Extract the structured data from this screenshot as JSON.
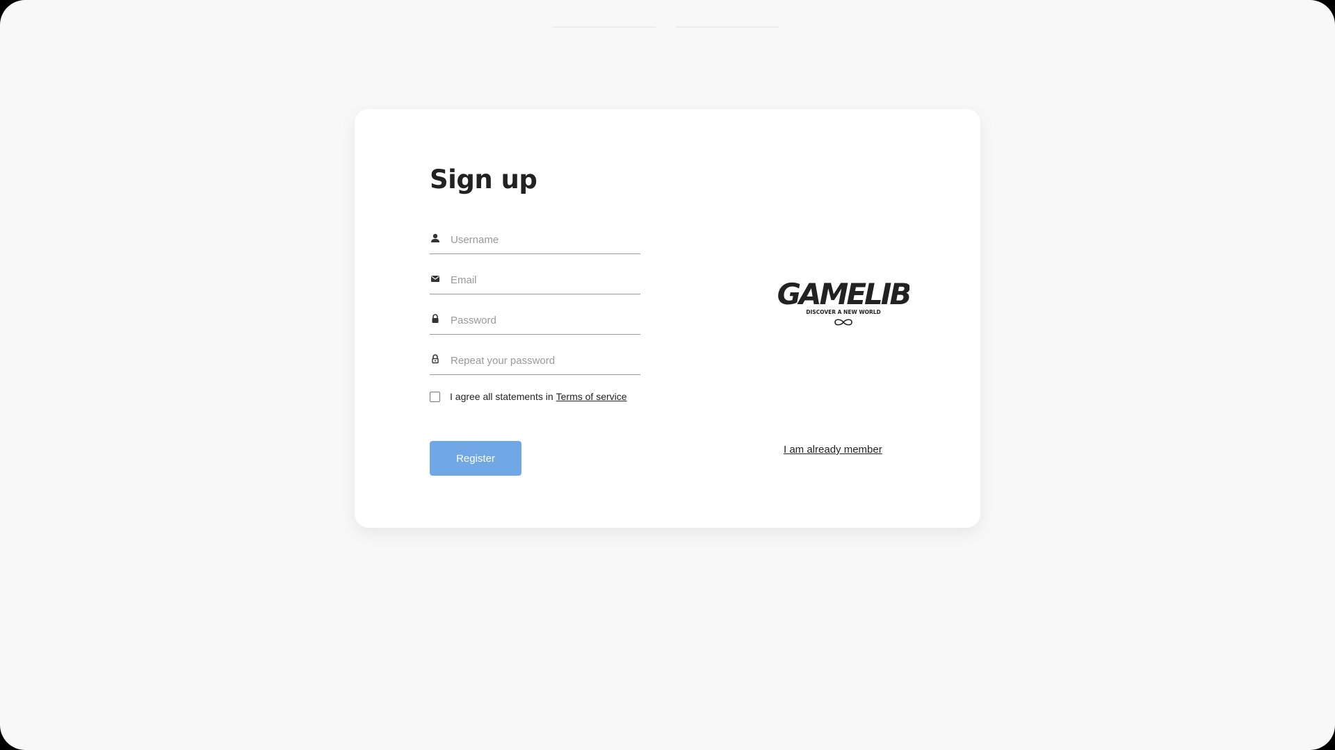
{
  "signup": {
    "title": "Sign up",
    "username_placeholder": "Username",
    "email_placeholder": "Email",
    "password_placeholder": "Password",
    "repeat_password_placeholder": "Repeat your password",
    "agree_text": "I agree all statements in",
    "terms_link": "Terms of service",
    "register_label": "Register",
    "already_member_link": "I am already member"
  },
  "logo": {
    "wordmark": "GAMELIB",
    "tagline": "DISCOVER A NEW WORLD"
  },
  "icons": {
    "username": "person-icon",
    "email": "envelope-icon",
    "password": "lock-icon",
    "repeat_password": "lock-outline-icon",
    "logo_mark": "infinity-icon"
  },
  "colors": {
    "page_background": "#f8f8f8",
    "card_background": "#ffffff",
    "register_button": "#6fa8e4",
    "text": "#222222"
  }
}
